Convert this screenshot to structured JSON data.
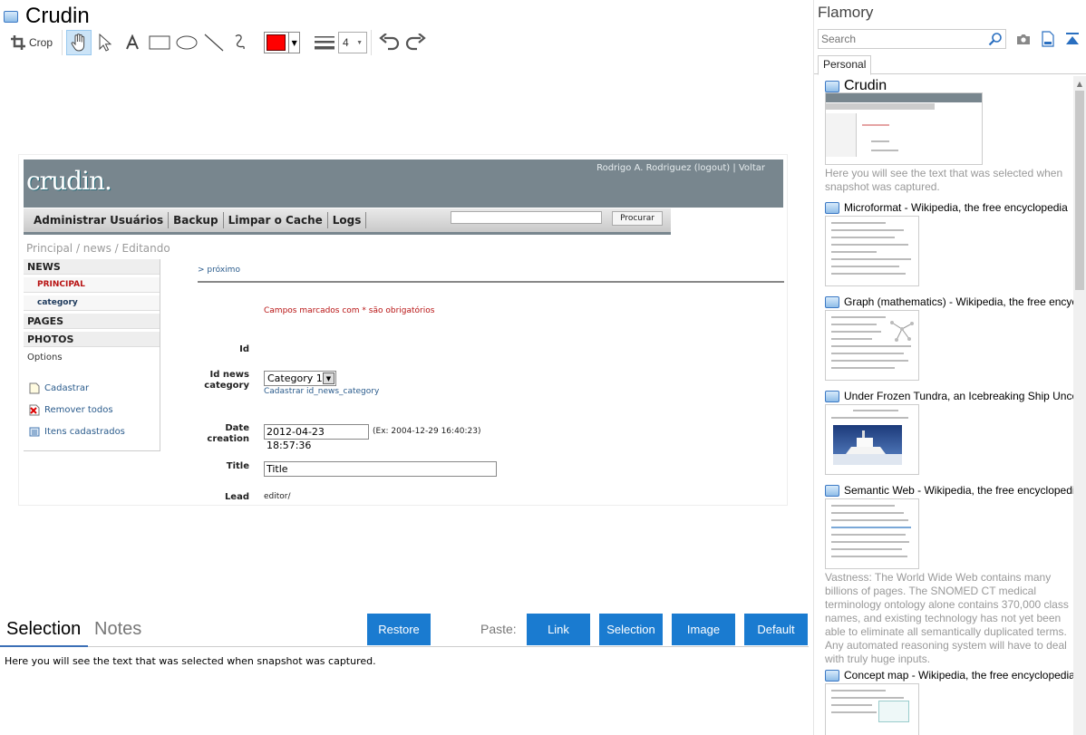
{
  "window": {
    "title": "Crudin"
  },
  "toolbar": {
    "crop_label": "Crop",
    "line_width": "4",
    "color": "#ff0000"
  },
  "snapshot": {
    "logo": "crudin.",
    "user_line": "Rodrigo A. Rodriguez (logout)  |  Voltar",
    "nav": [
      "Administrar Usuários",
      "Backup",
      "Limpar o Cache",
      "Logs"
    ],
    "search_button": "Procurar",
    "breadcrumb": "Principal / news / Editando",
    "sidebar": {
      "news": "NEWS",
      "principal": "PRINCIPAL",
      "category": "category",
      "pages": "PAGES",
      "photos": "PHOTOS",
      "options": "Options",
      "links": [
        "Cadastrar",
        "Remover todos",
        "Itens cadastrados"
      ]
    },
    "proximo": "> próximo",
    "required_note": "Campos marcados com * são obrigatórios",
    "fields": {
      "id_label": "Id",
      "id_news_category_label": "Id news category",
      "category_value": "Category 1",
      "category_link": "Cadastrar id_news_category",
      "date_label": "Date creation",
      "date_value": "2012-04-23 18:57:36",
      "date_example": "(Ex: 2004-12-29 16:40:23)",
      "title_label": "Title",
      "title_value": "Title",
      "lead_label": "Lead",
      "lead_value": "editor/"
    }
  },
  "bottom": {
    "tab_selection": "Selection",
    "tab_notes": "Notes",
    "restore": "Restore",
    "paste_label": "Paste:",
    "paste_buttons": [
      "Link",
      "Selection",
      "Image",
      "Default"
    ],
    "selection_text": "Here you will see the text that was selected when snapshot was captured."
  },
  "sidebar": {
    "title": "Flamory",
    "search_placeholder": "Search",
    "tab": "Personal",
    "items": [
      {
        "title": "Crudin",
        "desc": "Here you will see the text that was selected when snapshot was captured."
      },
      {
        "title": "Microformat - Wikipedia, the free encyclopedia"
      },
      {
        "title": "Graph (mathematics) - Wikipedia, the free encyclopedia"
      },
      {
        "title": "Under Frozen Tundra, an Icebreaking Ship Uncovers"
      },
      {
        "title": "Semantic Web - Wikipedia, the free encyclopedia",
        "desc": "Vastness: The World Wide Web contains many billions of pages. The SNOMED CT medical terminology ontology alone contains 370,000 class names, and existing technology has not yet been able to eliminate all semantically duplicated terms. Any automated reasoning system will have to deal with truly huge inputs."
      },
      {
        "title": "Concept map - Wikipedia, the free encyclopedia"
      }
    ]
  }
}
